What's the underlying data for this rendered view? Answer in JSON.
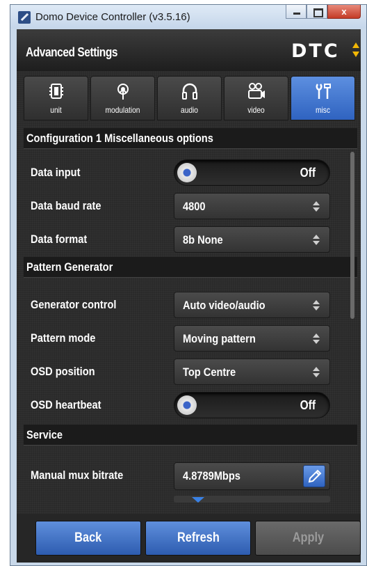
{
  "window": {
    "title": "Domo Device Controller (v3.5.16)",
    "close_glyph": "x"
  },
  "header": {
    "title": "Advanced Settings",
    "logo": "DTC"
  },
  "tabs": [
    {
      "label": "unit",
      "icon": "chip-icon"
    },
    {
      "label": "modulation",
      "icon": "antenna-icon"
    },
    {
      "label": "audio",
      "icon": "headphones-icon"
    },
    {
      "label": "video",
      "icon": "camera-icon"
    },
    {
      "label": "misc",
      "icon": "tools-icon",
      "active": true
    }
  ],
  "sections": {
    "misc": "Configuration 1 Miscellaneous options",
    "pattern": "Pattern Generator",
    "service": "Service"
  },
  "rows": {
    "data_input": {
      "label": "Data input",
      "value": "Off"
    },
    "data_baud_rate": {
      "label": "Data baud rate",
      "value": "4800"
    },
    "data_format": {
      "label": "Data format",
      "value": "8b None"
    },
    "generator_control": {
      "label": "Generator control",
      "value": "Auto video/audio"
    },
    "pattern_mode": {
      "label": "Pattern mode",
      "value": "Moving pattern"
    },
    "osd_position": {
      "label": "OSD position",
      "value": "Top Centre"
    },
    "osd_heartbeat": {
      "label": "OSD heartbeat",
      "value": "Off"
    },
    "manual_mux_bitrate": {
      "label": "Manual mux bitrate",
      "value": "4.8789Mbps"
    }
  },
  "footer": {
    "back": "Back",
    "refresh": "Refresh",
    "apply": "Apply"
  },
  "colors": {
    "accent": "#3a6fd0",
    "logo_arrow": "#f2b705",
    "background": "#2a2a2a"
  }
}
